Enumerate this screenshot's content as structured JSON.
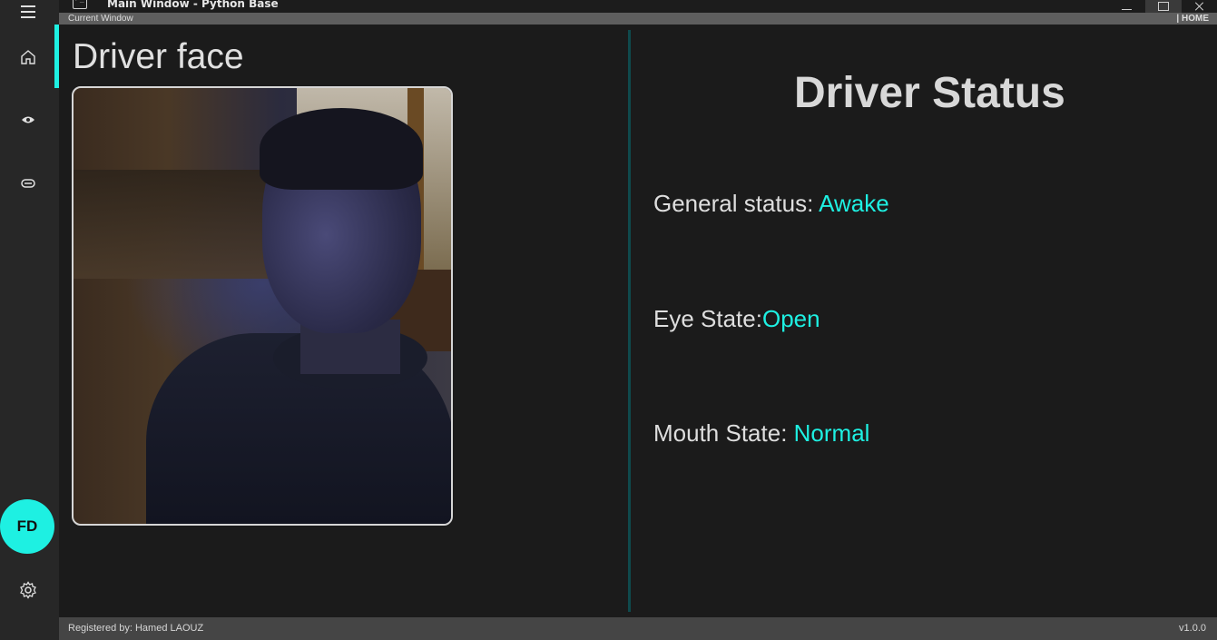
{
  "window": {
    "title": "Main Window - Python Base",
    "current_window_label": "Current Window",
    "current_page": "| HOME"
  },
  "sidebar": {
    "avatar_initials": "FD",
    "items": [
      {
        "icon": "hamburger-menu-icon"
      },
      {
        "icon": "home-icon"
      },
      {
        "icon": "eye-icon"
      },
      {
        "icon": "capsule-icon"
      },
      {
        "icon": "settings-gear-icon"
      }
    ]
  },
  "main": {
    "face_title": "Driver face",
    "status_title": "Driver Status",
    "status": [
      {
        "label": "General status: ",
        "value": "Awake"
      },
      {
        "label": "Eye State:",
        "value": "Open"
      },
      {
        "label": "Mouth State: ",
        "value": "Normal"
      }
    ]
  },
  "footer": {
    "registered": "Registered by: Hamed LAOUZ",
    "version": "v1.0.0"
  },
  "colors": {
    "accent": "#1ef0e2",
    "background": "#1b1b1b",
    "sidebar": "#272727",
    "footer": "#454545"
  }
}
